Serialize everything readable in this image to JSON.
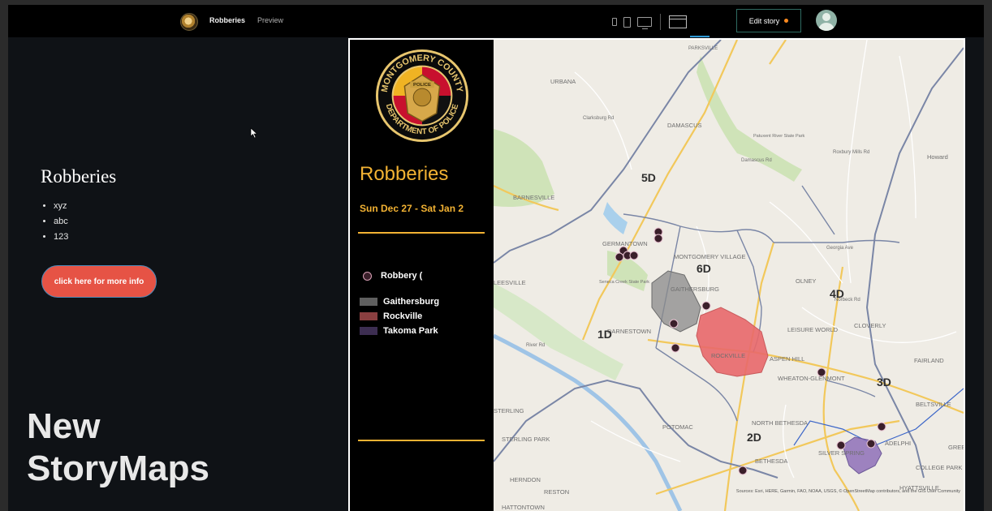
{
  "app": {
    "story_title": "Robberies",
    "preview_label": "Preview",
    "edit_button_label": "Edit story",
    "colors": {
      "accent_orange": "#ff8a1f",
      "active_blue": "#2f9ad6"
    }
  },
  "sidebar": {
    "heading": "Robberies",
    "bullets": [
      "xyz",
      "abc",
      "123"
    ],
    "button_label": "click here for more info",
    "button_color": "#e65345"
  },
  "watermark": {
    "line1": "New",
    "line2": "StoryMaps"
  },
  "embed": {
    "seal_text_top": "MONTGOMERY COUNTY",
    "seal_text_bottom": "DEPARTMENT OF POLICE",
    "seal_badge_text": "POLICE",
    "title": "Robberies",
    "dates": "Sun Dec 27 - Sat Jan 2",
    "legend": {
      "robbery_label": "Robbery (",
      "areas": [
        {
          "label": "Gaithersburg",
          "color": "#5f5f5f"
        },
        {
          "label": "Rockville",
          "color": "#8a3f40"
        },
        {
          "label": "Takoma Park",
          "color": "#3d2e52"
        }
      ]
    },
    "map": {
      "place_labels": [
        "URBANA",
        "DAMASCUS",
        "BARNESVILLE",
        "GERMANTOWN",
        "MONTGOMERY VILLAGE",
        "GAITHERSBURG",
        "OLNEY",
        "LEISURE WORLD",
        "CLOVERLY",
        "ROCKVILLE",
        "ASPEN HILL",
        "FAIRLAND",
        "WHEATON-GLENMONT",
        "BELTSVILLE",
        "POTOMAC",
        "NORTH BETHESDA",
        "BETHESDA",
        "SILVER SPRING",
        "ADELPHI",
        "COLLEGE PARK",
        "HYATTSVILLE",
        "STERLING",
        "STERLING PARK",
        "HERNDON",
        "RESTON",
        "HATTONTOWN",
        "DARNESTOWN",
        "LEESVILLE",
        "Howard",
        "Seneca Creek State Park",
        "Patuxent River State Park",
        "Damascus Rd",
        "Clarksburg Rd",
        "Georgia Ave",
        "Norbeck Rd",
        "Roxbury Mills Rd",
        "River Rd",
        "PARKSVILLE",
        "GREENBELT"
      ],
      "district_labels": [
        "5D",
        "6D",
        "4D",
        "1D",
        "3D",
        "2D"
      ],
      "attribution": "Sources: Esri, HERE, Garmin, FAO, NOAA, USGS, © OpenStreetMap contributors, and the GIS User Community"
    }
  }
}
